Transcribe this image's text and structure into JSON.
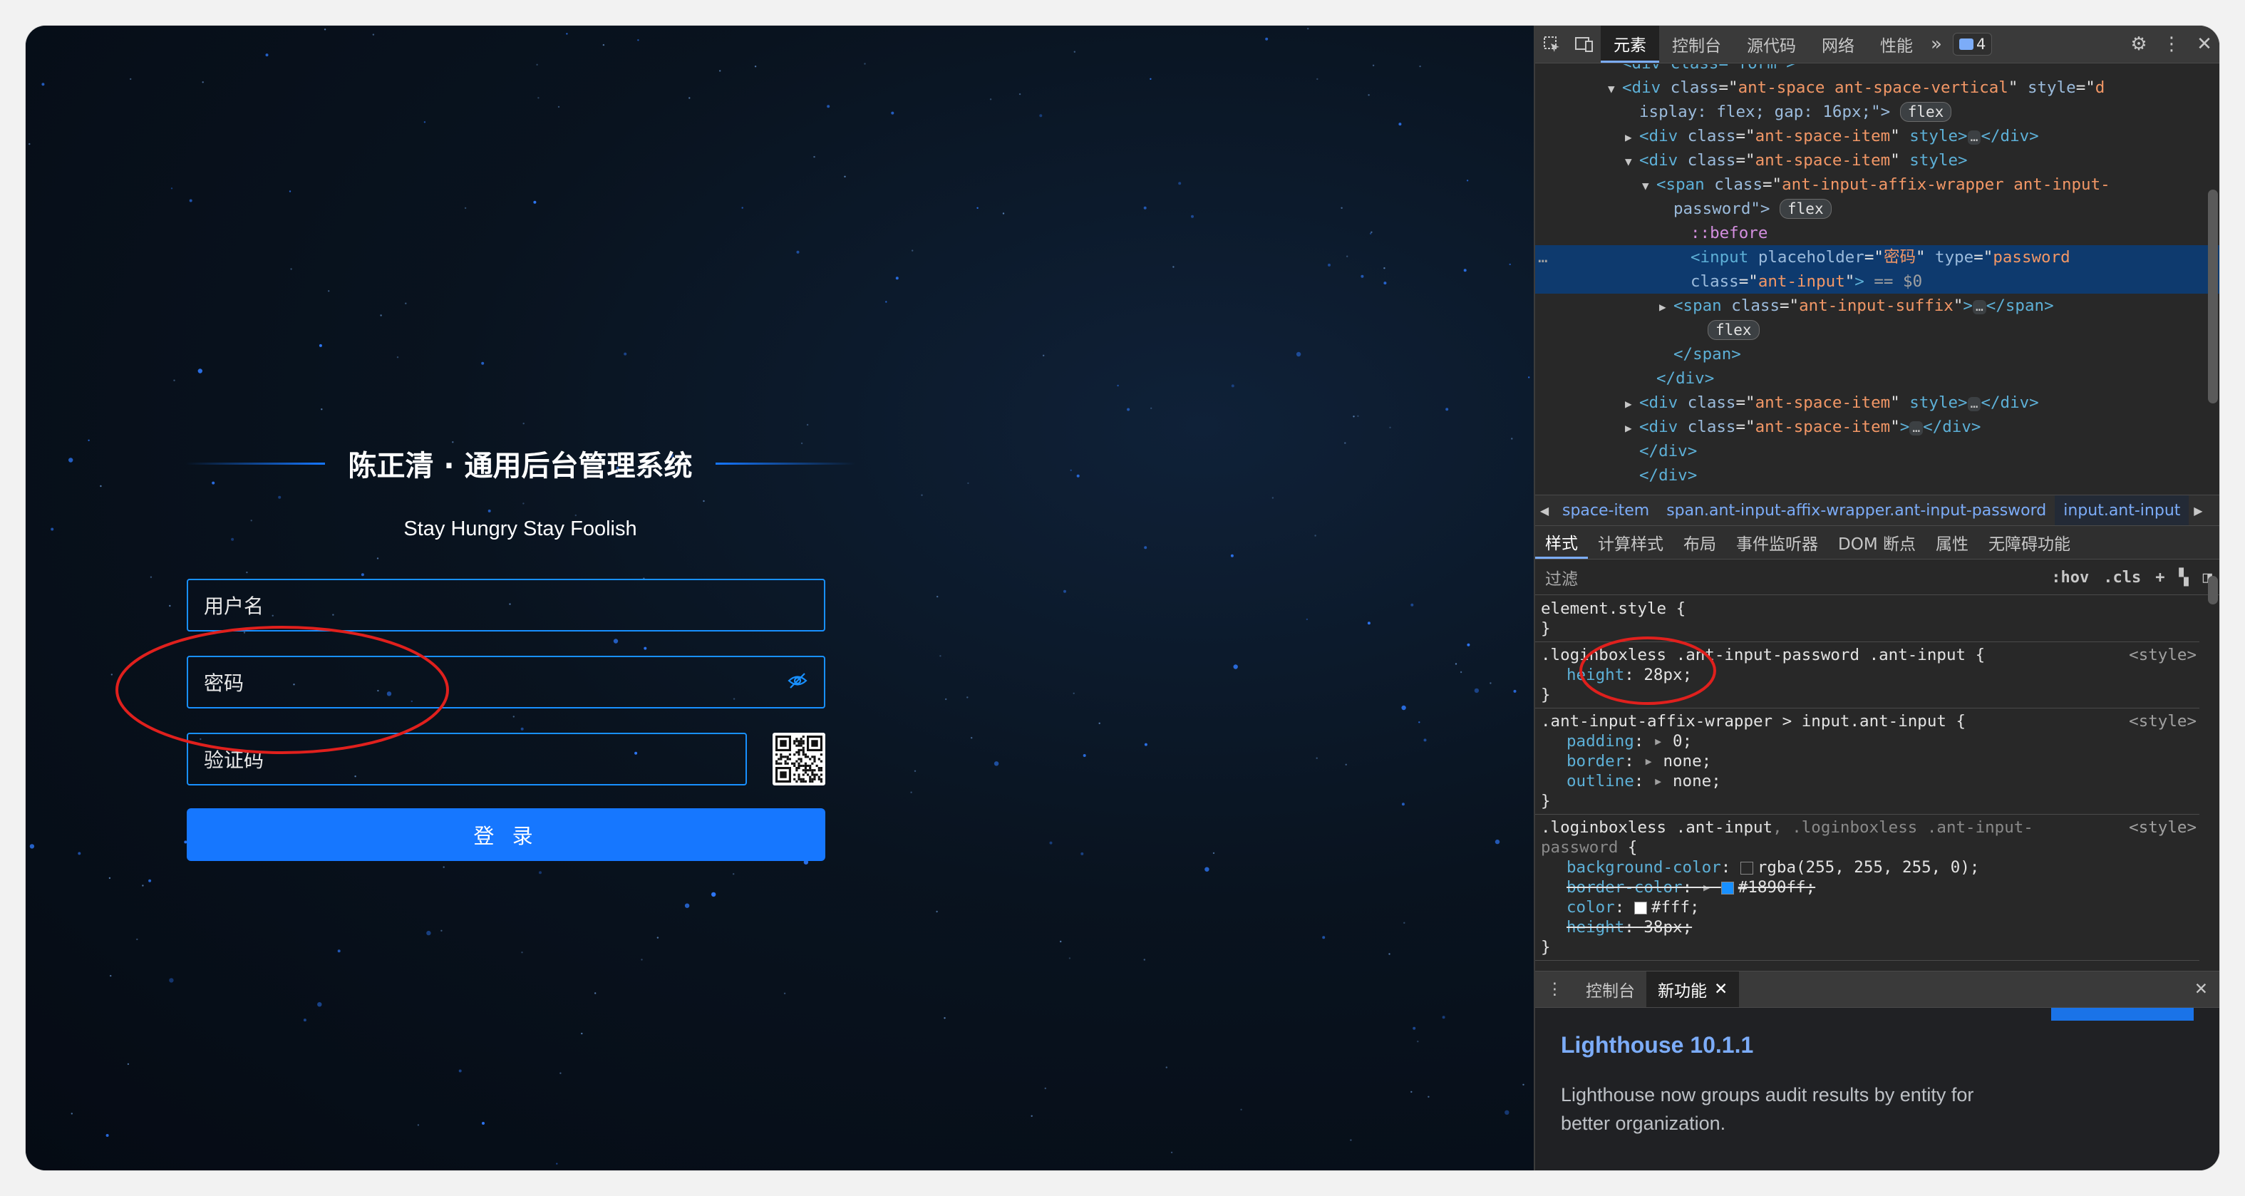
{
  "login": {
    "title": "陈正清 · 通用后台管理系统",
    "slogan": "Stay Hungry Stay Foolish",
    "username_placeholder": "用户名",
    "password_placeholder": "密码",
    "captcha_placeholder": "验证码",
    "login_button": "登 录",
    "accent_color": "#1677ff"
  },
  "devtools": {
    "tabs": [
      "元素",
      "控制台",
      "源代码",
      "网络",
      "性能"
    ],
    "active_tab": "元素",
    "issues_count": "4",
    "dom_lines": [
      {
        "indent": 7,
        "text": "<div class=\"form\">",
        "partial": true
      },
      {
        "indent": 7,
        "toggle": "open",
        "open": "<div",
        "attrs": [
          [
            "class",
            "ant-space ant-space-vertical"
          ],
          [
            "style",
            "d"
          ]
        ]
      },
      {
        "indent": 8,
        "text": "isplay: flex; gap: 16px;\">",
        "chip": "flex"
      },
      {
        "indent": 8,
        "toggle": "closed",
        "open": "<div",
        "attrs": [
          [
            "class",
            "ant-space-item"
          ]
        ],
        "tail": " style>",
        "ellipsis": true,
        "close": "</div>"
      },
      {
        "indent": 8,
        "toggle": "open",
        "open": "<div",
        "attrs": [
          [
            "class",
            "ant-space-item"
          ]
        ],
        "tail": " style>"
      },
      {
        "indent": 9,
        "toggle": "open",
        "open": "<span",
        "attrs": [
          [
            "class",
            "ant-input-affix-wrapper ant-input-"
          ]
        ]
      },
      {
        "indent": 10,
        "text": "password\">",
        "chip": "flex"
      },
      {
        "indent": 11,
        "pseudo": "::before"
      },
      {
        "indent": 11,
        "selected": true,
        "open": "<input",
        "attrs": [
          [
            "placeholder",
            "密码"
          ],
          [
            "type",
            "password"
          ]
        ]
      },
      {
        "indent": 11,
        "selected": true,
        "text": "class=\"ant-input\">",
        "suffix": " == $0"
      },
      {
        "indent": 10,
        "toggle": "closed",
        "open": "<span",
        "attrs": [
          [
            "class",
            "ant-input-suffix"
          ]
        ],
        "tail": ">",
        "ellipsis": true,
        "close": "</span>"
      },
      {
        "indent": 12,
        "chip_only": "flex"
      },
      {
        "indent": 10,
        "text": "</span>"
      },
      {
        "indent": 9,
        "text": "</div>"
      },
      {
        "indent": 8,
        "toggle": "closed",
        "open": "<div",
        "attrs": [
          [
            "class",
            "ant-space-item"
          ]
        ],
        "tail": " style>",
        "ellipsis": true,
        "close": "</div>"
      },
      {
        "indent": 8,
        "toggle": "closed",
        "open": "<div",
        "attrs": [
          [
            "class",
            "ant-space-item"
          ]
        ],
        "tail": ">",
        "ellipsis": true,
        "close": "</div>"
      },
      {
        "indent": 8,
        "text": "</div>"
      },
      {
        "indent": 8,
        "text": "</div>",
        "partial": true
      }
    ],
    "breadcrumbs": [
      "space-item",
      "span.ant-input-affix-wrapper.ant-input-password",
      "input.ant-input"
    ],
    "sub_tabs": [
      "样式",
      "计算样式",
      "布局",
      "事件监听器",
      "DOM 断点",
      "属性",
      "无障碍功能"
    ],
    "filter_label": "过滤",
    "filter_tools": [
      ":hov",
      ".cls"
    ],
    "rules": [
      {
        "selector": "element.style",
        "source": "",
        "decls": []
      },
      {
        "selector": ".loginboxless .ant-input-password .ant-input",
        "source": "<style>",
        "decls": [
          {
            "name": "height",
            "value": "28px",
            "struck": false
          }
        ]
      },
      {
        "selector": ".ant-input-affix-wrapper > input.ant-input",
        "source": "<style>",
        "decls": [
          {
            "name": "padding",
            "value": "0",
            "struck": false,
            "arrow": true
          },
          {
            "name": "border",
            "value": "none",
            "struck": false,
            "arrow": true
          },
          {
            "name": "outline",
            "value": "none",
            "struck": false,
            "arrow": true
          }
        ]
      },
      {
        "selector": ".loginboxless .ant-input",
        "selector_dim": ", .loginboxless .ant-input-",
        "selector_line2": "password",
        "source": "<style>",
        "decls": [
          {
            "name": "background-color",
            "value": "rgba(255, 255, 255, 0)",
            "struck": false,
            "swatch": "rgba(255,255,255,0)"
          },
          {
            "name": "border-color",
            "value": "#1890ff",
            "struck": true,
            "arrow": true,
            "swatch": "#1890ff"
          },
          {
            "name": "color",
            "value": "#fff",
            "struck": false,
            "swatch": "#ffffff"
          },
          {
            "name": "height",
            "value": "38px",
            "struck": true
          }
        ]
      }
    ],
    "drawer_tabs": [
      "控制台",
      "新功能"
    ],
    "drawer_active": "新功能",
    "lighthouse_title": "Lighthouse 10.1.1",
    "lighthouse_desc": "Lighthouse now groups audit results by entity for better organization."
  }
}
